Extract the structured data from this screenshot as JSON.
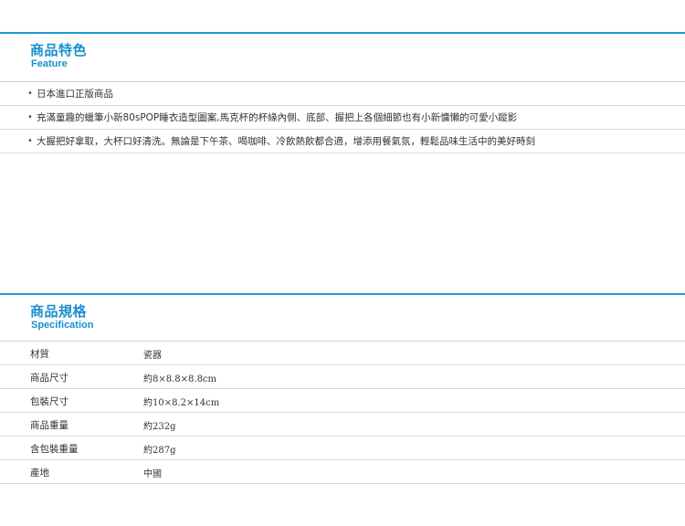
{
  "feature": {
    "title": "商品特色",
    "subtitle": "Feature",
    "bullet": "•",
    "items": [
      "日本進口正版商品",
      "充滿童趣的蠟筆小新80sPOP睡衣造型圖案,馬克杯的杯緣內側、底部、握把上各個細節也有小新慵懶的可愛小蹤影",
      "大握把好拿取，大杯口好清洗。無論是下午茶、喝咖啡、冷飲熱飲都合適，增添用餐氣氛，輕鬆品味生活中的美好時刻"
    ]
  },
  "specification": {
    "title": "商品規格",
    "subtitle": "Specification",
    "rows": [
      {
        "label": "材質",
        "value": "瓷器"
      },
      {
        "label": "商品尺寸",
        "value": "約8×8.8×8.8cm"
      },
      {
        "label": "包裝尺寸",
        "value": "約10×8.2×14cm"
      },
      {
        "label": "商品重量",
        "value": "約232g"
      },
      {
        "label": "含包裝重量",
        "value": "約287g"
      },
      {
        "label": "產地",
        "value": "中國"
      }
    ]
  },
  "colors": {
    "accent": "#1a8fcf",
    "divider": "#d9d9d9"
  }
}
